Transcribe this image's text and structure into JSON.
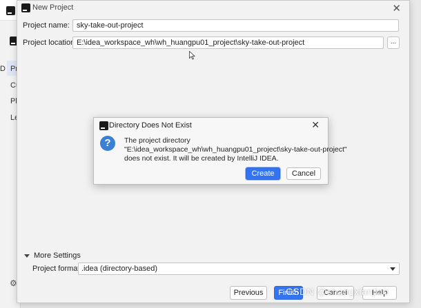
{
  "background_window": {
    "left_items": [
      "Pr",
      "Cu",
      "Pl",
      "Le"
    ],
    "left_letter": "D"
  },
  "dialog": {
    "title": "New Project",
    "project_name_label": "Project name:",
    "project_name_value": "sky-take-out-project",
    "project_location_label": "Project location:",
    "project_location_value": "E:\\idea_workspace_wh\\wh_huangpu01_project\\sky-take-out-project",
    "browse_label": "...",
    "more_settings_label": "More Settings",
    "project_format_label": "Project format:",
    "project_format_value": ".idea (directory-based)",
    "buttons": {
      "previous": "Previous",
      "finish": "Finish",
      "cancel": "Cancel",
      "help": "Help"
    }
  },
  "modal": {
    "title": "Directory Does Not Exist",
    "message_line1": "The project directory",
    "message_line2": "\"E:\\idea_workspace_wh\\wh_huangpu01_project\\sky-take-out-project\"",
    "message_line3": "does not exist. It will be created by IntelliJ IDEA.",
    "create_label": "Create",
    "cancel_label": "Cancel",
    "icon_glyph": "?"
  },
  "watermark": "CSDN @shangxianjiao",
  "icons": {
    "app_logo": "intellij-logo-icon",
    "close": "close-icon",
    "question": "question-icon"
  },
  "colors": {
    "accent": "#3574f0",
    "question_icon": "#3b7fd6"
  }
}
